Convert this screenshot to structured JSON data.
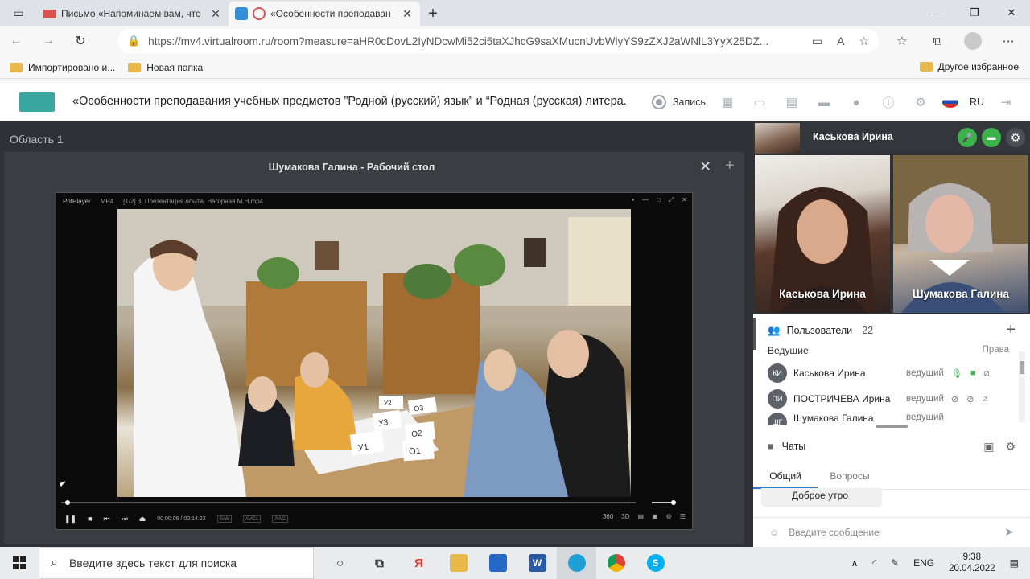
{
  "browser": {
    "tabs": [
      {
        "title": "Письмо «Напоминаем вам, что",
        "active": false
      },
      {
        "title": "«Особенности преподаван",
        "active": true
      }
    ],
    "url": "https://mv4.virtualroom.ru/room?measure=aHR0cDovL2IyNDcwMi52ci5taXJhcG9saXMucnUvbWlyYS9zZXJ2aWNlL3YyX25DZ...",
    "bookmarks": [
      {
        "label": "Импортировано и..."
      },
      {
        "label": "Новая папка"
      }
    ],
    "bookmarks_right": "Другое избранное"
  },
  "app": {
    "meeting_title": "«Особенности преподавания учебных предметов ”Родной (русский) язык” и “Родная (русская) литера...",
    "record_label": "Запись",
    "language": "RU"
  },
  "stage": {
    "area_label": "Область 1",
    "window_title": "Шумакова Галина - Рабочий стол",
    "player": {
      "app_name": "PotPlayer",
      "format": "MP4",
      "file": "[1/2] 3. Презентация опыта. Нагорная М.Н.mp4",
      "time_current": "00:00:06",
      "time_total": "00:14:22",
      "tags": [
        "S/W",
        "AVC1",
        "AAC"
      ],
      "progress_fraction": 0.007,
      "volume_fraction": 0.85
    },
    "video_labels": [
      "У1",
      "О1",
      "О2",
      "У3",
      "О3",
      "У2"
    ]
  },
  "side": {
    "me_name": "Каськова Ирина",
    "tiles": [
      {
        "name": "Каськова Ирина"
      },
      {
        "name": "Шумакова Галина"
      }
    ],
    "users_label": "Пользователи",
    "users_count": "22",
    "hosts_label": "Ведущие",
    "rights_label": "Права",
    "users": [
      {
        "initials": "КИ",
        "name": "Каськова Ирина",
        "role": "ведущий"
      },
      {
        "initials": "ПИ",
        "name": "ПОСТРИЧЕВА Ирина",
        "role": "ведущий"
      },
      {
        "initials": "ШГ",
        "name": "Шумакова Галина",
        "role": "ведущий"
      }
    ],
    "chats_label": "Чаты",
    "chat_tabs": [
      "Общий",
      "Вопросы"
    ],
    "last_message": "Доброе утро",
    "input_placeholder": "Введите сообщение"
  },
  "taskbar": {
    "search_placeholder": "Введите здесь текст для поиска",
    "lang": "ENG",
    "time": "9:38",
    "date": "20.04.2022"
  }
}
